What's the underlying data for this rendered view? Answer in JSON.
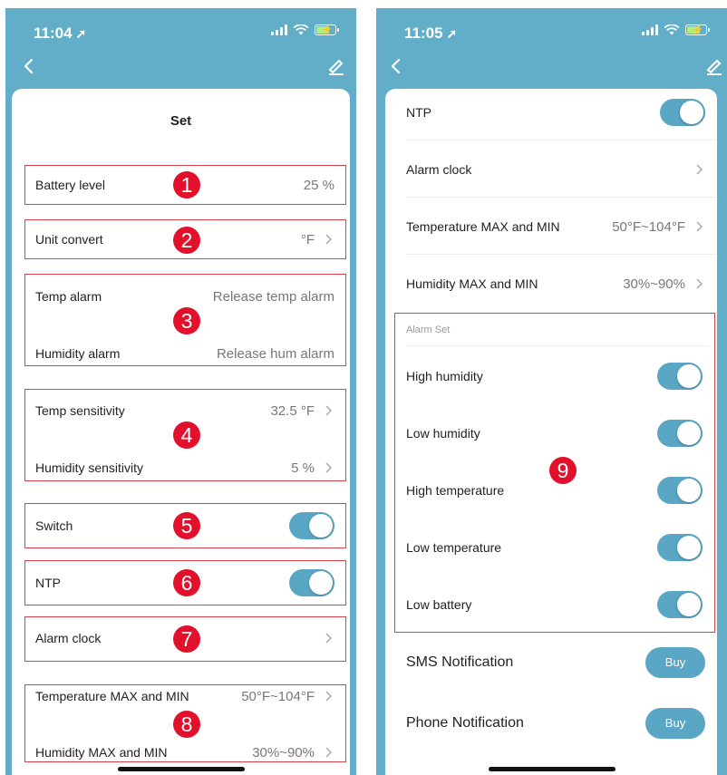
{
  "left": {
    "status_time": "11:04",
    "title": "Set",
    "rows": {
      "battery": {
        "label": "Battery level",
        "value": "25 %"
      },
      "unit": {
        "label": "Unit convert",
        "value": "°F"
      },
      "temp_alarm": {
        "label": "Temp alarm",
        "value": "Release temp alarm"
      },
      "hum_alarm": {
        "label": "Humidity alarm",
        "value": "Release hum alarm"
      },
      "temp_sens": {
        "label": "Temp sensitivity",
        "value": "32.5 °F"
      },
      "hum_sens": {
        "label": "Humidity sensitivity",
        "value": "5 %"
      },
      "switch": {
        "label": "Switch"
      },
      "ntp": {
        "label": "NTP"
      },
      "alarm_clock": {
        "label": "Alarm clock"
      },
      "temp_maxmin": {
        "label": "Temperature MAX and MIN",
        "value": "50°F~104°F"
      },
      "hum_maxmin": {
        "label": "Humidity MAX and MIN",
        "value": "30%~90%"
      }
    },
    "markers": [
      "1",
      "2",
      "3",
      "4",
      "5",
      "6",
      "7",
      "8"
    ]
  },
  "right": {
    "status_time": "11:05",
    "rows": {
      "ntp": {
        "label": "NTP"
      },
      "alarm_clock": {
        "label": "Alarm clock"
      },
      "temp_maxmin": {
        "label": "Temperature MAX and MIN",
        "value": "50°F~104°F"
      },
      "hum_maxmin": {
        "label": "Humidity MAX and MIN",
        "value": "30%~90%"
      }
    },
    "alarm_set": {
      "title": "Alarm Set",
      "items": [
        {
          "label": "High humidity",
          "on": true
        },
        {
          "label": "Low humidity",
          "on": true
        },
        {
          "label": "High temperature",
          "on": true
        },
        {
          "label": "Low temperature",
          "on": true
        },
        {
          "label": "Low battery",
          "on": true
        }
      ]
    },
    "marker": "9",
    "sms": {
      "label": "SMS Notification",
      "button": "Buy"
    },
    "phone": {
      "label": "Phone Notification",
      "button": "Buy"
    }
  },
  "colors": {
    "header": "#62aec8",
    "toggle": "#5aa6c5",
    "annotation_box": "#d9414b",
    "annotation_marker": "#e3102b"
  },
  "icons": [
    "back-arrow-icon",
    "edit-icon",
    "chevron-right-icon",
    "location-arrow-icon",
    "signal-icon",
    "wifi-icon",
    "battery-charging-icon"
  ]
}
